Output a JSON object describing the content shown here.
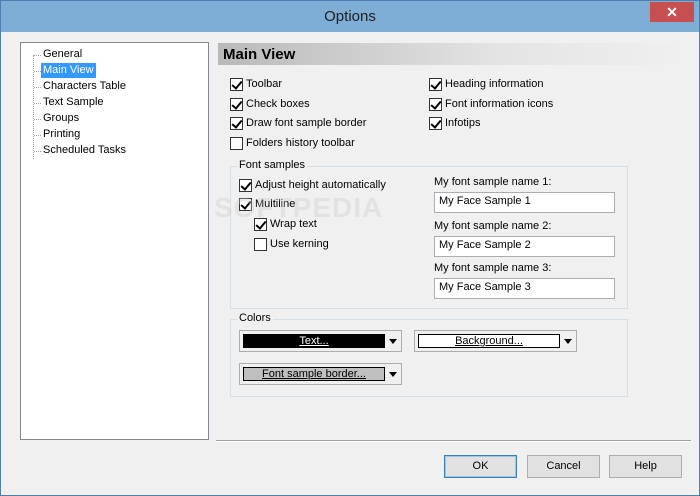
{
  "window": {
    "title": "Options",
    "close_icon": "✕"
  },
  "tree": {
    "items": [
      {
        "label": "General"
      },
      {
        "label": "Main View",
        "selected": true
      },
      {
        "label": "Characters Table"
      },
      {
        "label": "Text Sample"
      },
      {
        "label": "Groups"
      },
      {
        "label": "Printing"
      },
      {
        "label": "Scheduled Tasks"
      }
    ]
  },
  "main": {
    "header": "Main View",
    "options_left": [
      {
        "label": "Toolbar",
        "checked": true
      },
      {
        "label": "Check boxes",
        "checked": true
      },
      {
        "label": "Draw font sample border",
        "checked": true
      },
      {
        "label": "Folders history toolbar",
        "checked": false
      }
    ],
    "options_right": [
      {
        "label": "Heading information",
        "checked": true
      },
      {
        "label": "Font information icons",
        "checked": true
      },
      {
        "label": "Infotips",
        "checked": true
      }
    ],
    "font_samples": {
      "label": "Font samples",
      "adjust_height": {
        "label": "Adjust height automatically",
        "checked": true
      },
      "multiline": {
        "label": "Multiline",
        "checked": true
      },
      "wrap_text": {
        "label": "Wrap text",
        "checked": true
      },
      "use_kerning": {
        "label": "Use kerning",
        "checked": false
      },
      "names": [
        {
          "label": "My font sample name 1:",
          "value": "My Face Sample 1"
        },
        {
          "label": "My font sample name 2:",
          "value": "My Face Sample 2"
        },
        {
          "label": "My font sample name 3:",
          "value": "My Face Sample 3"
        }
      ]
    },
    "colors": {
      "label": "Colors",
      "text": {
        "label": "Text...",
        "color": "#000000",
        "text_color": "#ffffff"
      },
      "background": {
        "label": "Background...",
        "color": "#ffffff",
        "text_color": "#000000"
      },
      "border": {
        "label": "Font sample border...",
        "color": "#c0c0c0",
        "text_color": "#000000"
      }
    }
  },
  "buttons": {
    "ok": "OK",
    "cancel": "Cancel",
    "help": "Help"
  },
  "watermark": "SOFTPEDIA"
}
